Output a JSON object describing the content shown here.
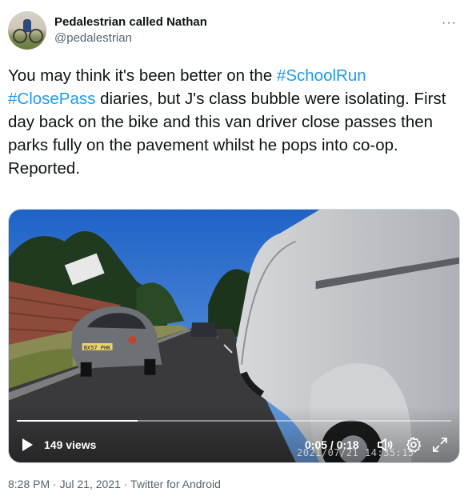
{
  "author": {
    "display_name": "Pedalestrian called Nathan",
    "handle": "@pedalestrian"
  },
  "more_icon": "more-horizontal-icon",
  "tweet": {
    "part1": "You may think it's been better on the ",
    "hashtag1": "#SchoolRun",
    "part2": "\n",
    "hashtag2": "#ClosePass",
    "part3": " diaries, but J's class bubble were isolating. First day back on the bike and this van driver close passes then parks fully on the pavement whilst he pops into co-op.\nReported."
  },
  "video": {
    "views": "149 views",
    "time": "0:05 / 0:18",
    "progress": 0.278,
    "burned_timestamp": "2021/07/21 14:35:15",
    "plate_text": "BX57 PHK"
  },
  "footer": {
    "meta": "8:28 PM · Jul 21, 2021 · Twitter for Android"
  },
  "colors": {
    "link": "#1d9bf0",
    "secondary": "#536471",
    "text": "#0f1419"
  }
}
